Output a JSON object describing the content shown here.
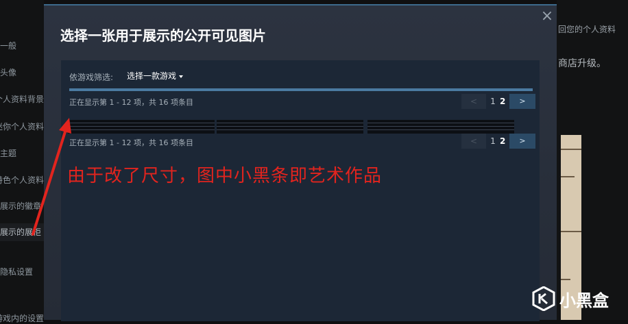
{
  "background": {
    "sidebar_items": [
      {
        "label": "一般",
        "active": false
      },
      {
        "label": "头像",
        "active": false
      },
      {
        "label": "个人资料背景",
        "active": false
      },
      {
        "label": "迷你个人资料",
        "active": false
      },
      {
        "label": "主题",
        "active": false
      },
      {
        "label": "特色个人资料",
        "active": false
      },
      {
        "label": "展示的徽章",
        "active": false
      },
      {
        "label": "展示的展柜",
        "active": true
      },
      {
        "label": "隐私设置",
        "active": false
      },
      {
        "label": "在游戏内的设置",
        "active": false
      }
    ],
    "right_text_1": "回您的个人资料",
    "right_text_2": "商店升级。"
  },
  "modal": {
    "title": "选择一张用于展示的公开可见图片",
    "close_symbol": "×",
    "filter_label": "依游戏筛选:",
    "filter_value": "选择一款游戏",
    "paging_top": "正在显示第 1 - 12 项，共 16 项条目",
    "paging_bottom": "正在显示第 1 - 12 项，共 16 项条目",
    "pager": {
      "prev": "<",
      "pages": [
        "1",
        "2"
      ],
      "current": "2",
      "next": ">"
    },
    "thumbnails": [
      {
        "name": "artwork-1"
      },
      {
        "name": "artwork-2"
      },
      {
        "name": "artwork-3"
      }
    ]
  },
  "annotation": {
    "text": "由于改了尺寸，图中小黑条即艺术作品",
    "color": "#e2241e"
  },
  "watermark": {
    "text": "小黑盒"
  },
  "colors": {
    "modal_bg": "#2a303b",
    "content_bg": "#1c2736",
    "accent": "#4b7aa1",
    "next_button": "#2b4a66"
  }
}
